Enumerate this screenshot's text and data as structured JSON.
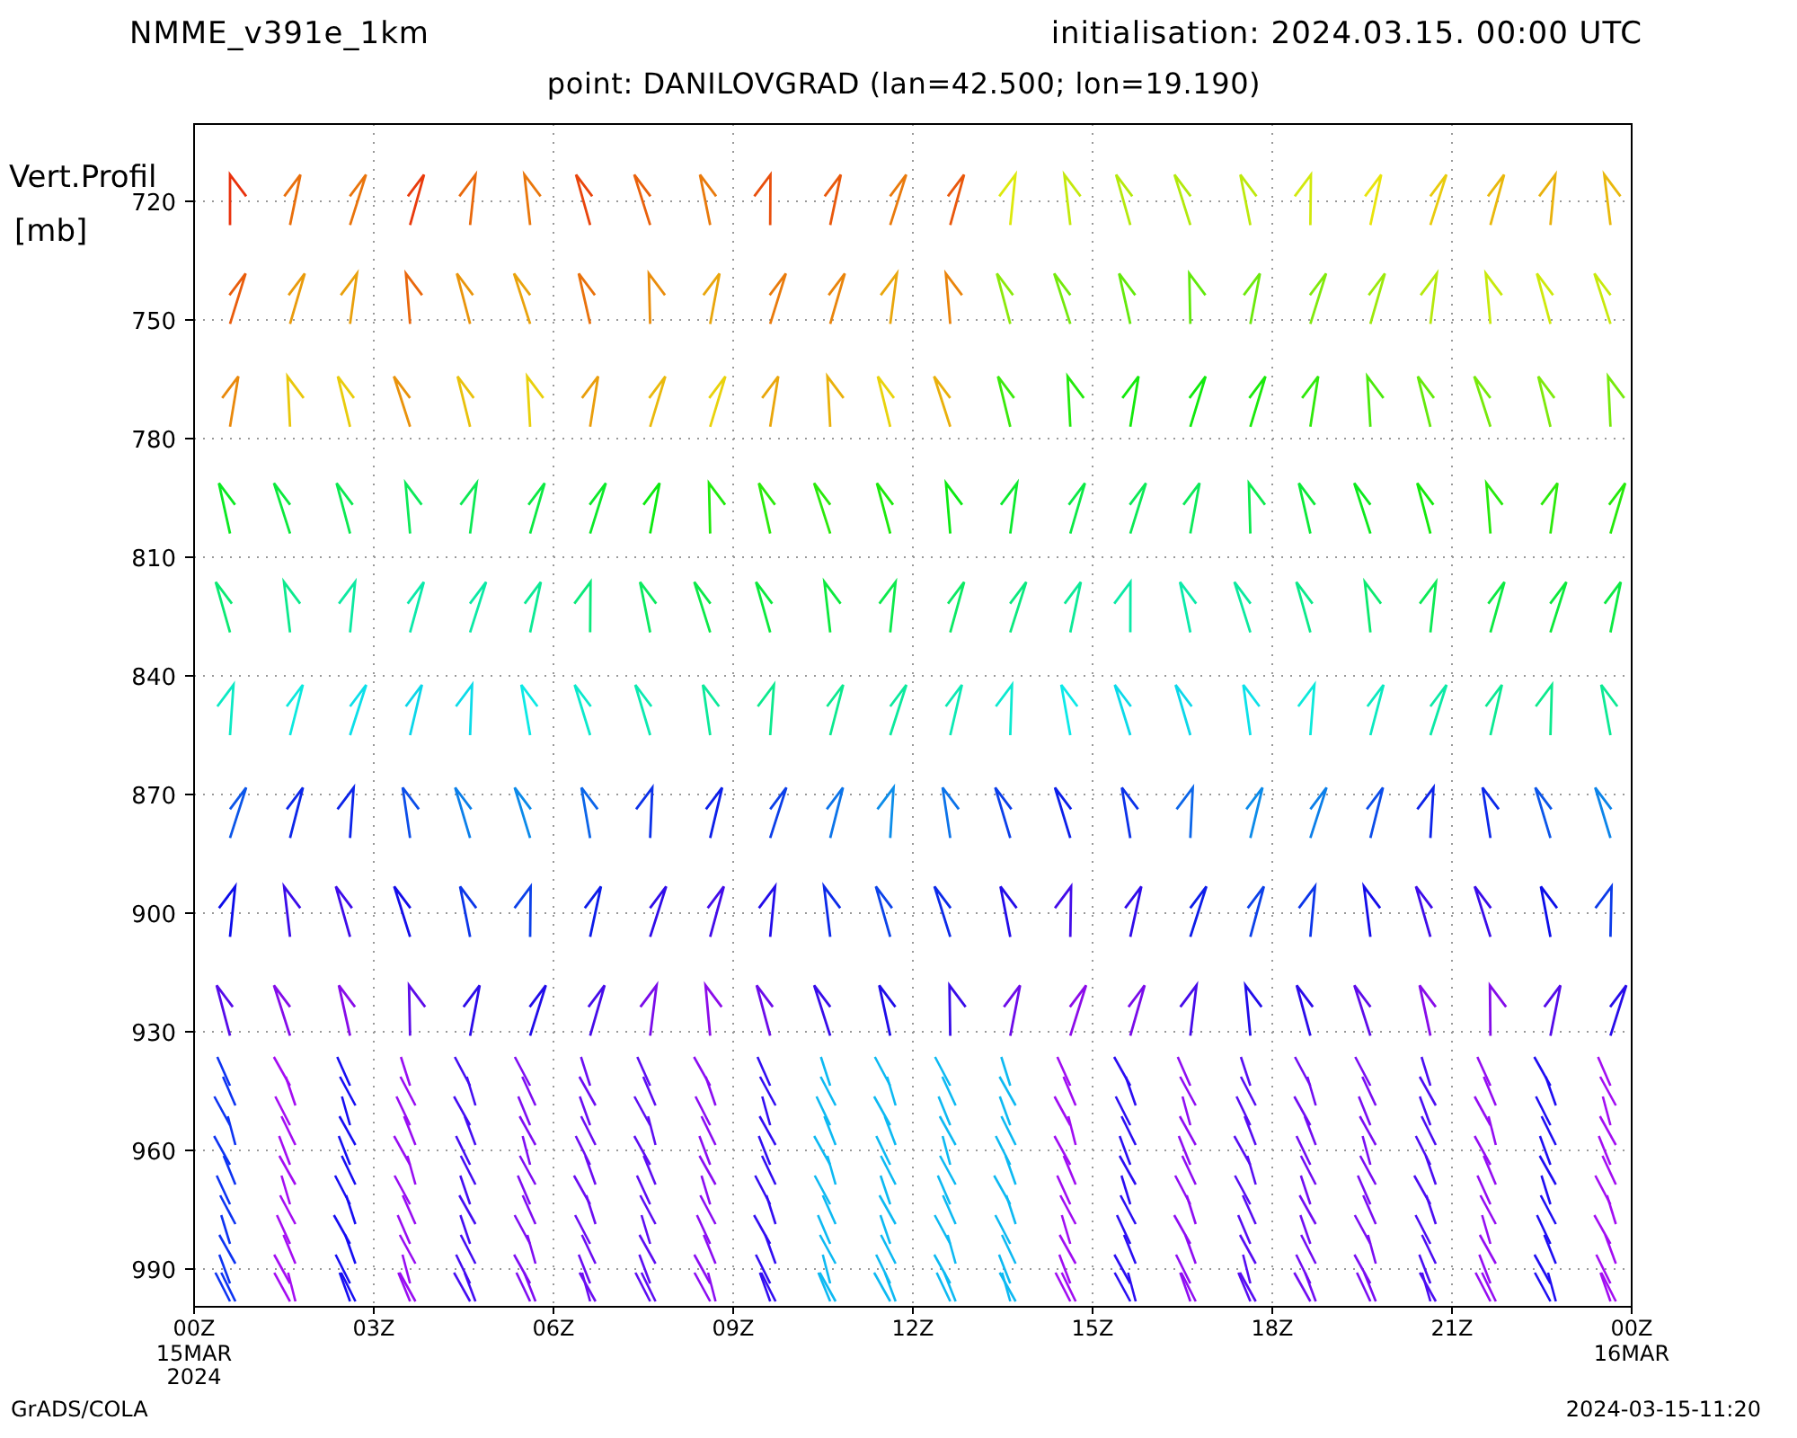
{
  "header": {
    "model": "NMME_v391e_1km",
    "initialisation": "initialisation: 2024.03.15. 00:00 UTC",
    "point": "point: DANILOVGRAD (lan=42.500; lon=19.190)"
  },
  "plot": {
    "ylabel": [
      "Vert.Profil",
      "[mb]"
    ],
    "yticks": [
      "720",
      "750",
      "780",
      "810",
      "840",
      "870",
      "900",
      "930",
      "960",
      "990"
    ],
    "xticks": [
      {
        "label": "00Z",
        "date": "15MAR",
        "year": "2024"
      },
      {
        "label": "03Z"
      },
      {
        "label": "06Z"
      },
      {
        "label": "09Z"
      },
      {
        "label": "12Z"
      },
      {
        "label": "15Z"
      },
      {
        "label": "18Z"
      },
      {
        "label": "21Z"
      },
      {
        "label": "00Z",
        "date": "16MAR"
      }
    ]
  },
  "footer": {
    "left": "GrADS/COLA",
    "right": "2024-03-15-11:20"
  }
}
